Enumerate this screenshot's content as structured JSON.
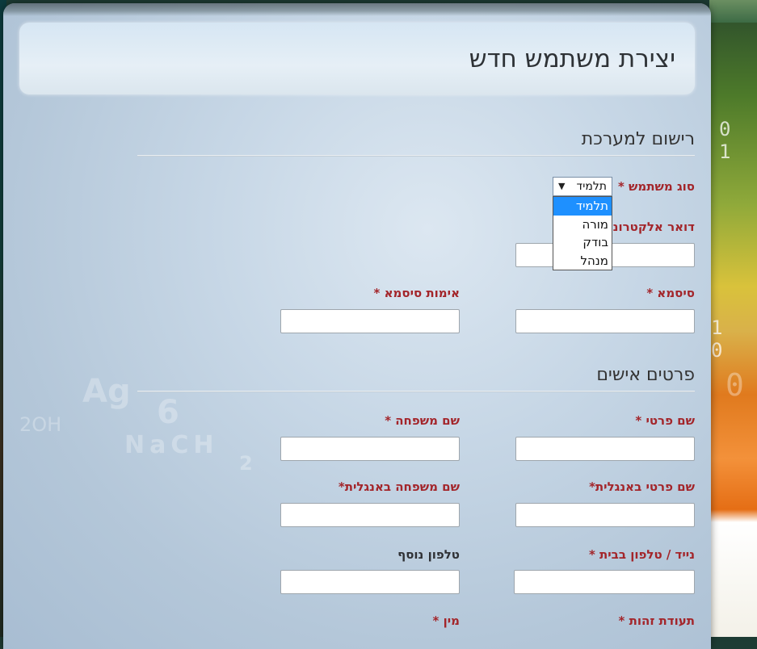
{
  "page_title": "יצירת משתמש חדש",
  "sections": {
    "registration": "רישום למערכת",
    "personal": "פרטים אישים"
  },
  "fields": {
    "user_type": {
      "label": "סוג משתמש *",
      "value": "תלמיד",
      "options": [
        "תלמיד",
        "מורה",
        "בודק",
        "מנהל"
      ],
      "highlighted_option": "תלמיד"
    },
    "email": {
      "label": "דואר אלקטרוני",
      "value": ""
    },
    "password": {
      "label": "סיסמא *",
      "value": ""
    },
    "password_confirm": {
      "label": "אימות סיסמא *",
      "value": ""
    },
    "first_name": {
      "label": "שם פרטי *",
      "value": ""
    },
    "last_name": {
      "label": "שם משפחה *",
      "value": ""
    },
    "first_name_en": {
      "label": "שם פרטי באנגלית*",
      "value": ""
    },
    "last_name_en": {
      "label": "שם משפחה באנגלית*",
      "value": ""
    },
    "phone": {
      "label": "נייד / טלפון בבית *",
      "value": ""
    },
    "phone_extra": {
      "label": "טלפון נוסף",
      "value": ""
    },
    "id_number": {
      "label": "תעודת זהות *"
    },
    "gender": {
      "label": "מין *"
    }
  },
  "background": {
    "right_ticks": [
      "0 1",
      "1 0",
      "0"
    ],
    "watermark": [
      "Ag",
      "6",
      "NaCH",
      "2",
      "2OH"
    ]
  },
  "colors": {
    "required_label": "#a3252a",
    "optional_label": "#2f3135",
    "dropdown_highlight": "#1e90ff"
  }
}
